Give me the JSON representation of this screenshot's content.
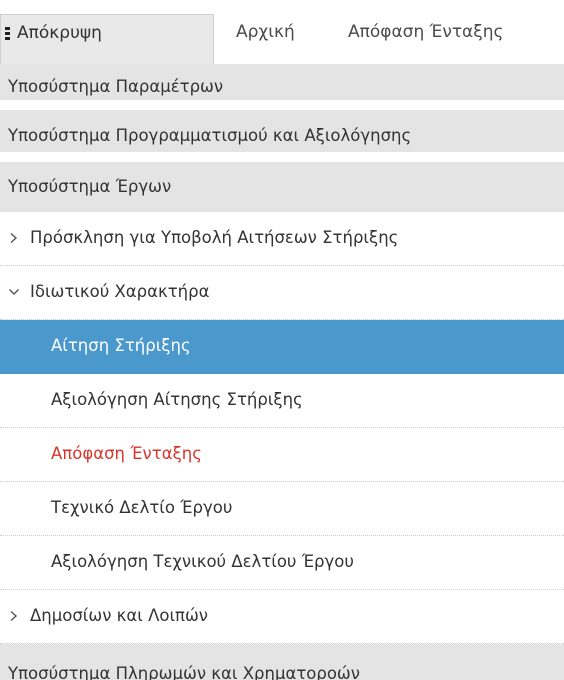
{
  "tabs": {
    "hide_label": "Απόκρυψη",
    "home_label": "Αρχική",
    "decision_label": "Απόφαση Ένταξης"
  },
  "menu": {
    "sections": [
      {
        "label": "Υποσύστημα Παραμέτρων"
      },
      {
        "label": "Υποσύστημα Προγραμματισμού και Αξιολόγησης"
      },
      {
        "label": "Υποσύστημα Έργων"
      }
    ],
    "groups": [
      {
        "label": "Πρόσκληση για Υποβολή Αιτήσεων Στήριξης",
        "state": "collapsed"
      },
      {
        "label": "Ιδιωτικού Χαρακτήρα",
        "state": "expanded"
      },
      {
        "label": "Δημοσίων και Λοιπών",
        "state": "collapsed"
      }
    ],
    "items": [
      {
        "label": "Αίτηση Στήριξης",
        "state": "selected"
      },
      {
        "label": "Αξιολόγηση Αίτησης Στήριξης"
      },
      {
        "label": "Απόφαση Ένταξης",
        "state": "highlighted"
      },
      {
        "label": "Τεχνικό Δελτίο Έργου"
      },
      {
        "label": "Αξιολόγηση Τεχνικού Δελτίου Έργου"
      }
    ],
    "footer_section": {
      "label": "Υποσύστημα Πληρωμών και Χρηματοροών"
    }
  },
  "colors": {
    "selected_bg": "#4a98cc",
    "highlight_text": "#d9342b",
    "section_bg": "#e4e4e4"
  }
}
